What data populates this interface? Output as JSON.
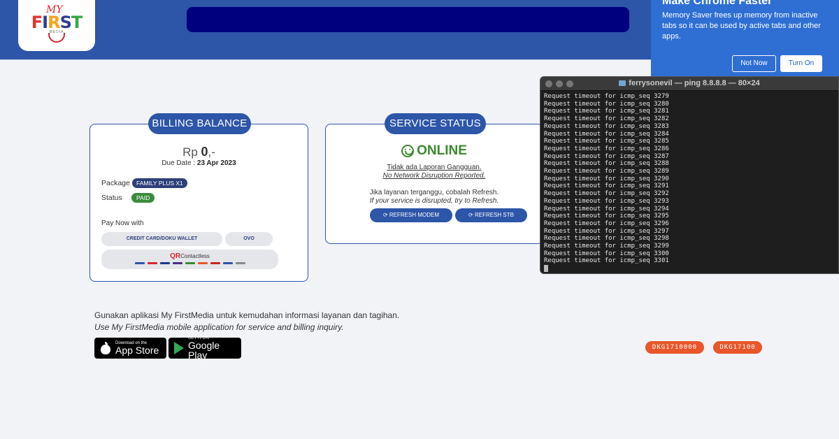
{
  "logo": {
    "my": "MY",
    "first": [
      "F",
      "I",
      "R",
      "S",
      "T"
    ],
    "sub": "MEDIA"
  },
  "billing": {
    "title": "BILLING BALANCE",
    "currency": "Rp",
    "amount": "0",
    "amount_suffix": ",-",
    "due_label": "Due Date :",
    "due_date": "23 Apr 2023",
    "package_label": "Package",
    "package_value": "FAMILY PLUS X1",
    "status_label": "Status",
    "status_value": "PAID",
    "pay_label": "Pay Now with",
    "pay_card": "CREDIT CARD/DOKU WALLET",
    "pay_ovo": "OVO",
    "qr_title": "QR",
    "qr_sub": "Contactless"
  },
  "service": {
    "title": "SERVICE STATUS",
    "status": "ONLINE",
    "line1": "Tidak ada Laporan Gangguan.",
    "line2": "No Network Disruption Reported.",
    "line3": "Jika layanan terganggu, cobalah Refresh.",
    "line4": "If your service is disrupted, try to Refresh.",
    "refresh_modem": "⟳ REFRESH MODEM",
    "refresh_stb": "⟳ REFRESH STB"
  },
  "app_promo": {
    "line_id": "Gunakan aplikasi My FirstMedia untuk kemudahan informasi layanan dan tagihan.",
    "line_en": "Use My FirstMedia mobile application for service and billing inquiry.",
    "appstore_small": "Download on the",
    "appstore_big": "App Store",
    "play_small": "GET IT ON",
    "play_big": "Google Play"
  },
  "codes": [
    "DKG1710000",
    "DKG17100"
  ],
  "chrome_popup": {
    "title": "Make Chrome Faster",
    "message": "Memory Saver frees up memory from inactive tabs so it can be used by active tabs and other apps.",
    "not_now": "Not Now",
    "turn_on": "Turn On"
  },
  "terminal": {
    "title": "ferrysonevil — ping 8.8.8.8 — 80×24",
    "lines": [
      "Request timeout for icmp_seq 3279",
      "Request timeout for icmp_seq 3280",
      "Request timeout for icmp_seq 3281",
      "Request timeout for icmp_seq 3282",
      "Request timeout for icmp_seq 3283",
      "Request timeout for icmp_seq 3284",
      "Request timeout for icmp_seq 3285",
      "Request timeout for icmp_seq 3286",
      "Request timeout for icmp_seq 3287",
      "Request timeout for icmp_seq 3288",
      "Request timeout for icmp_seq 3289",
      "Request timeout for icmp_seq 3290",
      "Request timeout for icmp_seq 3291",
      "Request timeout for icmp_seq 3292",
      "Request timeout for icmp_seq 3293",
      "Request timeout for icmp_seq 3294",
      "Request timeout for icmp_seq 3295",
      "Request timeout for icmp_seq 3296",
      "Request timeout for icmp_seq 3297",
      "Request timeout for icmp_seq 3298",
      "Request timeout for icmp_seq 3299",
      "Request timeout for icmp_seq 3300",
      "Request timeout for icmp_seq 3301"
    ]
  }
}
